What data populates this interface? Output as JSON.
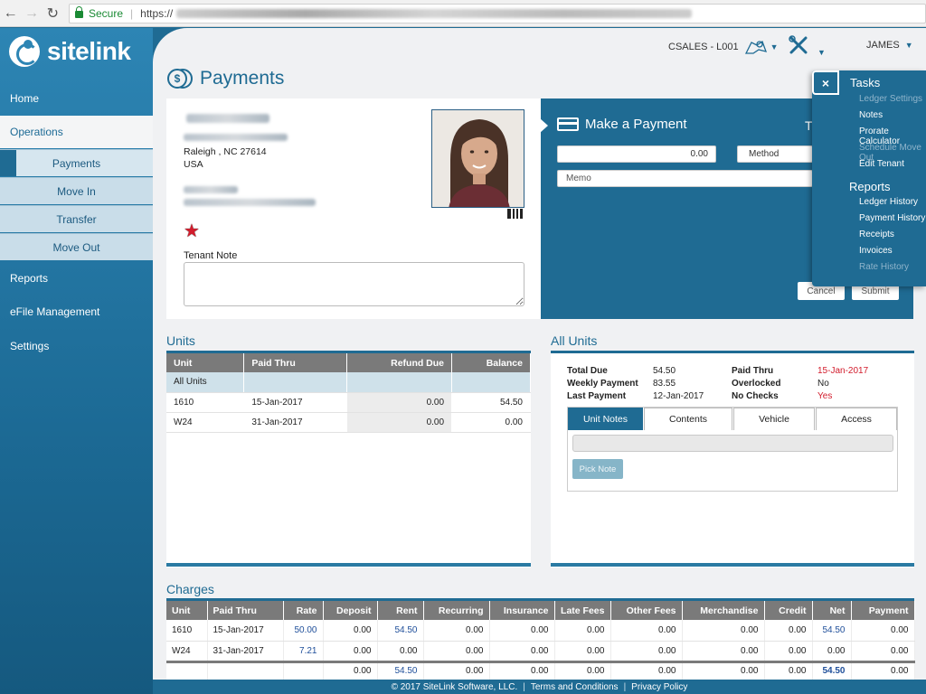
{
  "browser": {
    "secure_label": "Secure",
    "url_prefix": "https://"
  },
  "app": {
    "logo_text": "sitelink",
    "header": {
      "facility": "CSALES - L001",
      "user": "JAMES"
    },
    "page_title": "Payments"
  },
  "sidebar": {
    "home": "Home",
    "operations": "Operations",
    "sub_items": [
      "Payments",
      "Move In",
      "Transfer",
      "Move Out"
    ],
    "reports": "Reports",
    "efile": "eFile Management",
    "settings": "Settings"
  },
  "tenant": {
    "address_line": "Raleigh , NC 27614",
    "country": "USA",
    "note_label": "Tenant Note",
    "note_value": ""
  },
  "payment": {
    "title": "Make a Payment",
    "title_overflow": "T",
    "amount": "0.00",
    "method_placeholder": "Method",
    "memo_placeholder": "Memo",
    "cancel_label": "Cancel",
    "submit_label": "Submit"
  },
  "tasks_menu": {
    "close_glyph": "×",
    "tasks_heading": "Tasks",
    "task_items": [
      {
        "label": "Ledger Settings",
        "enabled": false
      },
      {
        "label": "Notes",
        "enabled": true
      },
      {
        "label": "Prorate Calculator",
        "enabled": true
      },
      {
        "label": "Schedule Move Out",
        "enabled": false
      },
      {
        "label": "Edit Tenant",
        "enabled": true
      }
    ],
    "reports_heading": "Reports",
    "report_items": [
      {
        "label": "Ledger History",
        "enabled": true
      },
      {
        "label": "Payment History",
        "enabled": true
      },
      {
        "label": "Receipts",
        "enabled": true
      },
      {
        "label": "Invoices",
        "enabled": true
      },
      {
        "label": "Rate History",
        "enabled": false
      }
    ]
  },
  "units": {
    "title": "Units",
    "columns": [
      "Unit",
      "Paid Thru",
      "Refund Due",
      "Balance"
    ],
    "all_units_label": "All Units",
    "rows": [
      {
        "unit": "1610",
        "paid_thru": "15-Jan-2017",
        "refund_due": "0.00",
        "balance": "54.50"
      },
      {
        "unit": "W24",
        "paid_thru": "31-Jan-2017",
        "refund_due": "0.00",
        "balance": "0.00"
      }
    ]
  },
  "all_units": {
    "title": "All Units",
    "total_due_label": "Total Due",
    "total_due": "54.50",
    "weekly_payment_label": "Weekly Payment",
    "weekly_payment": "83.55",
    "last_payment_label": "Last Payment",
    "last_payment": "12-Jan-2017",
    "paid_thru_label": "Paid Thru",
    "paid_thru": "15-Jan-2017",
    "overlocked_label": "Overlocked",
    "overlocked": "No",
    "no_checks_label": "No Checks",
    "no_checks": "Yes",
    "tabs": [
      "Unit Notes",
      "Contents",
      "Vehicle",
      "Access"
    ],
    "pick_note_label": "Pick Note"
  },
  "charges": {
    "title": "Charges",
    "columns": [
      "Unit",
      "Paid Thru",
      "Rate",
      "Deposit",
      "Rent",
      "Recurring",
      "Insurance",
      "Late Fees",
      "Other Fees",
      "Merchandise",
      "Credit",
      "Net",
      "Payment"
    ],
    "rows": [
      [
        "1610",
        "15-Jan-2017",
        "50.00",
        "0.00",
        "54.50",
        "0.00",
        "0.00",
        "0.00",
        "0.00",
        "0.00",
        "0.00",
        "54.50",
        "0.00"
      ],
      [
        "W24",
        "31-Jan-2017",
        "7.21",
        "0.00",
        "0.00",
        "0.00",
        "0.00",
        "0.00",
        "0.00",
        "0.00",
        "0.00",
        "0.00",
        "0.00"
      ]
    ],
    "totals": [
      "",
      "",
      "",
      "0.00",
      "54.50",
      "0.00",
      "0.00",
      "0.00",
      "0.00",
      "0.00",
      "0.00",
      "54.50",
      "0.00"
    ]
  },
  "footer": {
    "copyright": "© 2017 SiteLink Software, LLC.",
    "separator": "|",
    "terms": "Terms and Conditions",
    "privacy": "Privacy Policy"
  },
  "colors": {
    "brand_blue": "#1f6b93",
    "alert_red": "#d21c2c",
    "link_blue": "#1f4f9a"
  }
}
